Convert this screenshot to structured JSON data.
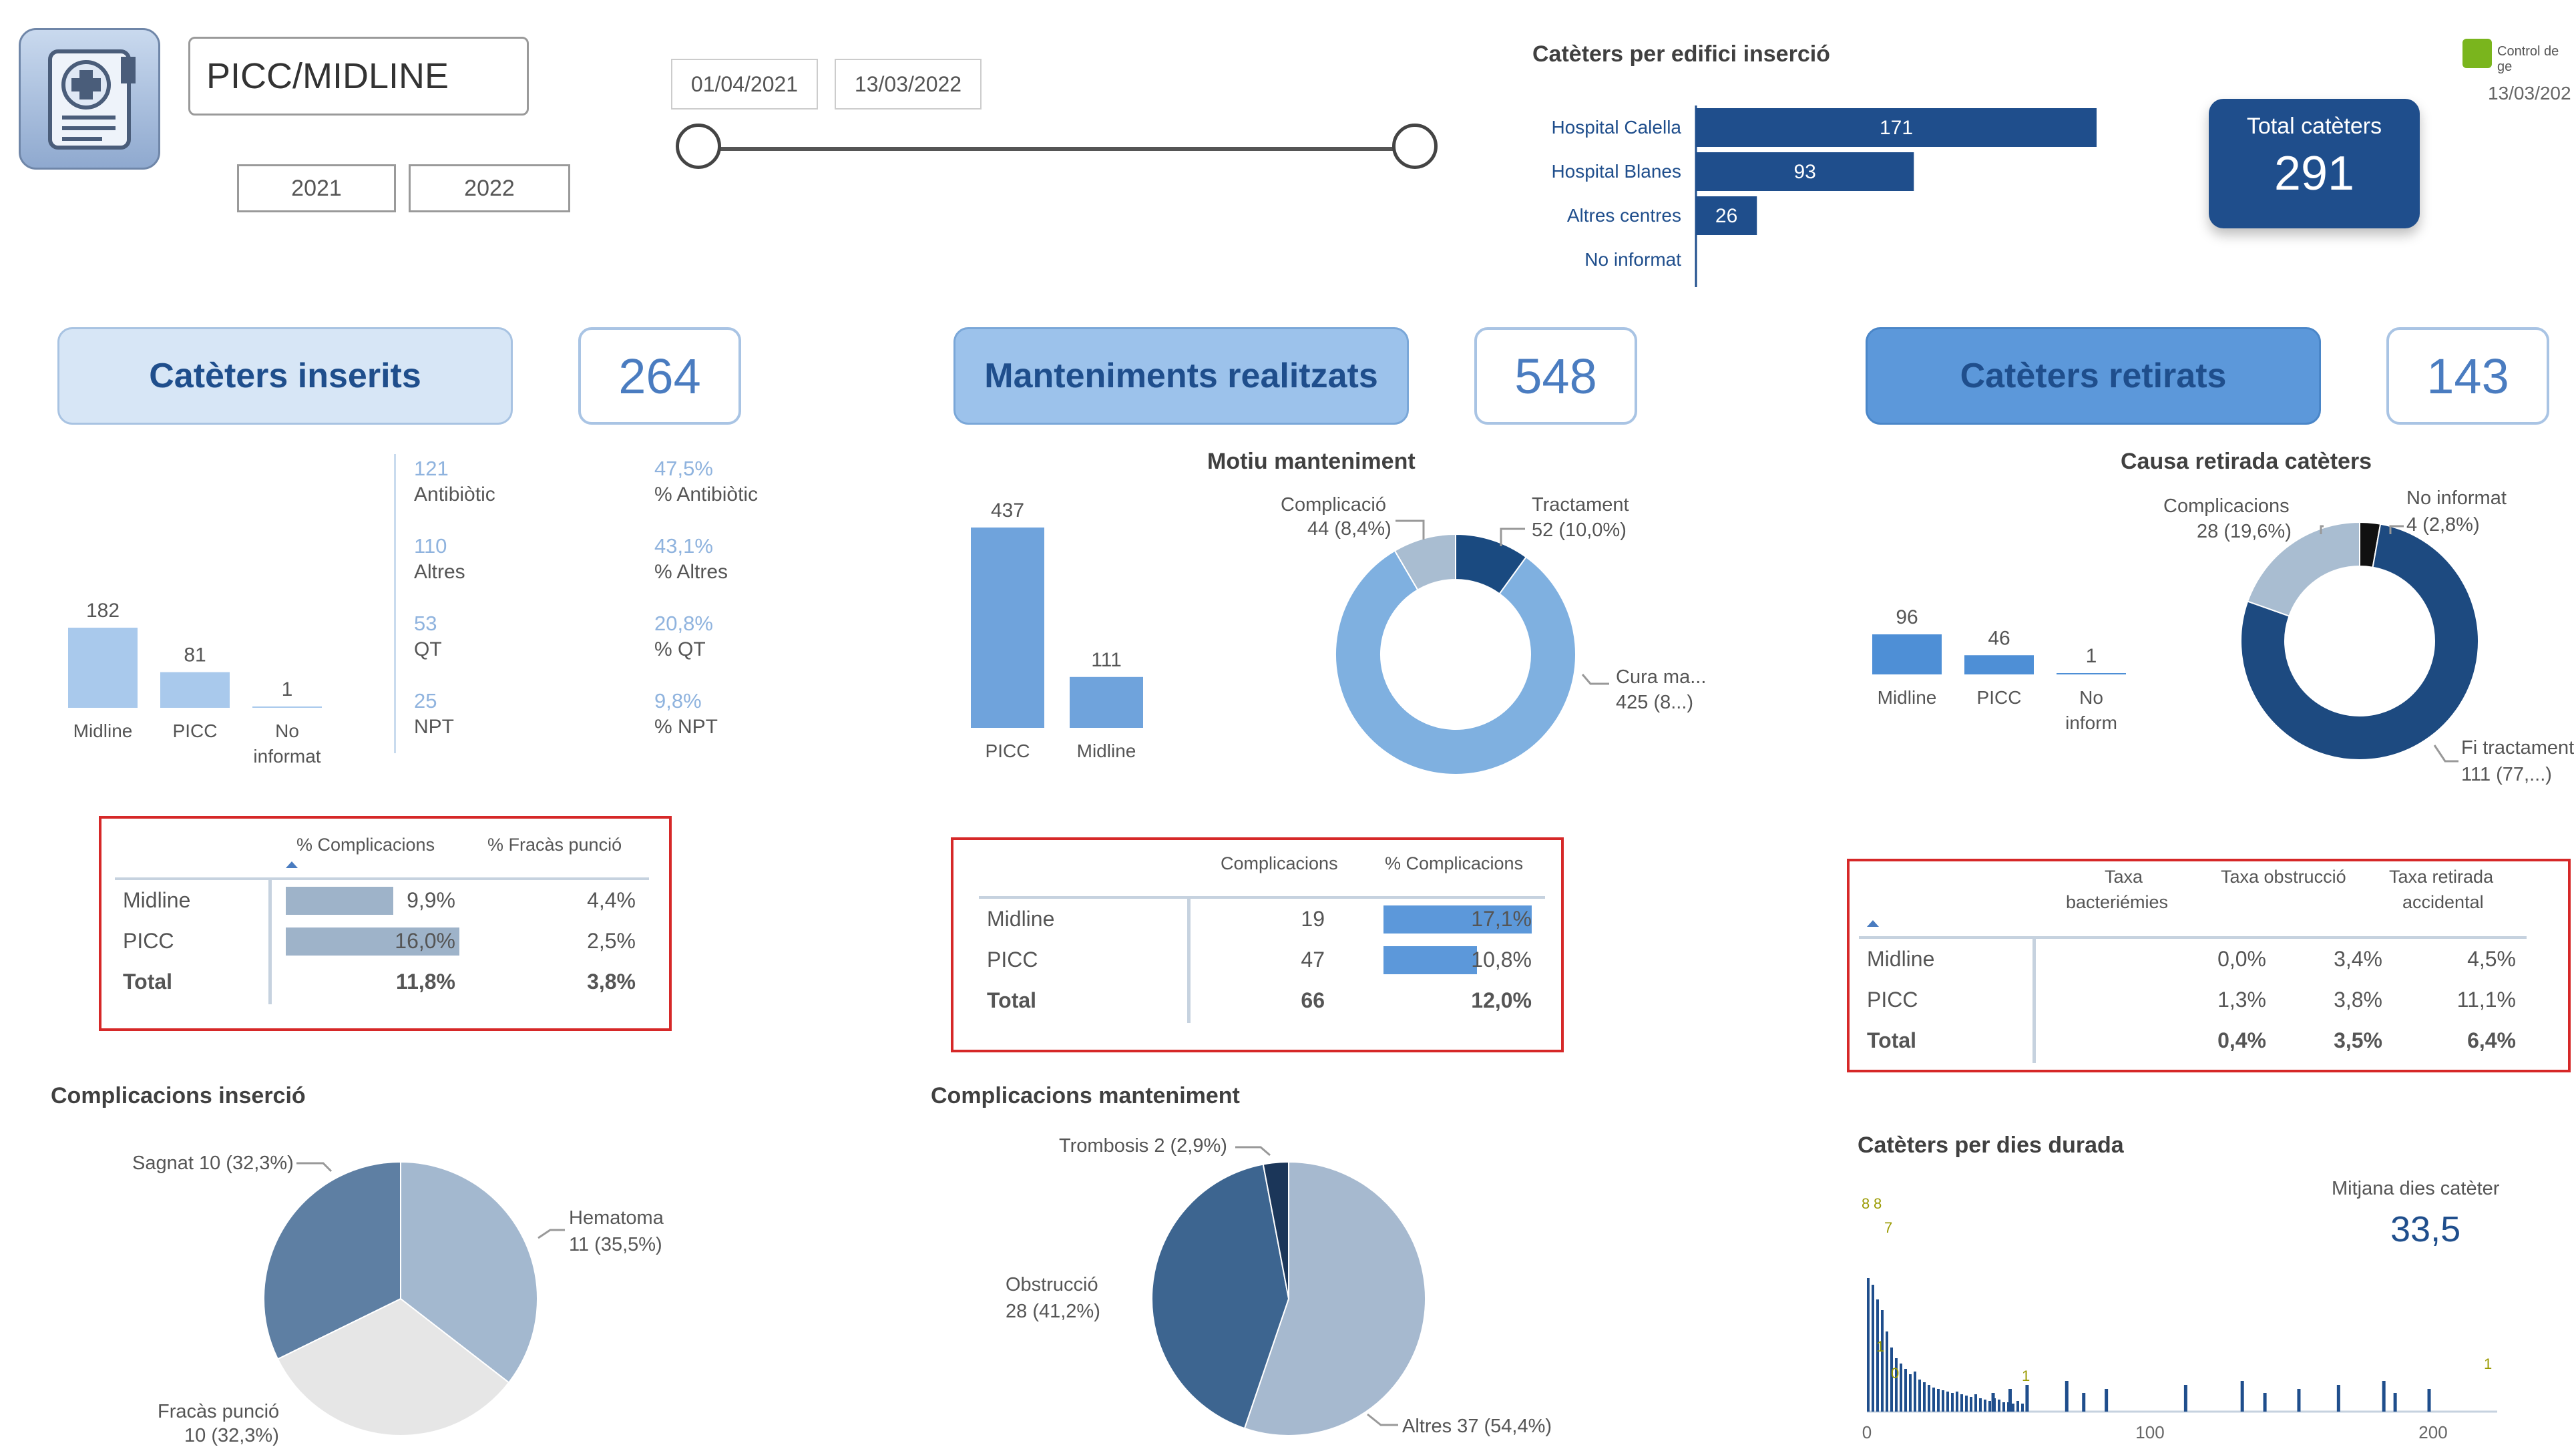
{
  "header": {
    "app_title": "PICC/MIDLINE",
    "year_buttons": [
      "2021",
      "2022"
    ],
    "date_start": "01/04/2021",
    "date_end": "13/03/2022",
    "brand_text": "Control de ge",
    "brand_date": "13/03/202"
  },
  "hospital_chart": {
    "title": "Catèters per edifici inserció",
    "bars": [
      {
        "label": "Hospital Calella",
        "value": 171
      },
      {
        "label": "Hospital Blanes",
        "value": 93
      },
      {
        "label": "Altres centres",
        "value": 26
      },
      {
        "label": "No informat",
        "value": 0
      }
    ],
    "value_labels": [
      "171",
      "93",
      "26"
    ]
  },
  "total_card": {
    "label": "Total catèters",
    "value": "291"
  },
  "sections": {
    "inserits": {
      "label": "Catèters inserits",
      "count": "264"
    },
    "manteniments": {
      "label": "Manteniments realitzats",
      "count": "548"
    },
    "retirats": {
      "label": "Catèters retirats",
      "count": "143"
    }
  },
  "inserits_bars": {
    "bars": [
      {
        "label": "Midline",
        "value": 182
      },
      {
        "label": "PICC",
        "value": 81
      },
      {
        "label": "No\ninformat",
        "value": 1
      }
    ],
    "value_labels": [
      "182",
      "81",
      "1"
    ],
    "label_1": "Midline",
    "label_2": "PICC",
    "label_3a": "No",
    "label_3b": "informat"
  },
  "inserits_kpis": [
    {
      "value": "121",
      "label": "Antibiòtic",
      "pct": "47,5%",
      "pct_label": "% Antibiòtic"
    },
    {
      "value": "110",
      "label": "Altres",
      "pct": "43,1%",
      "pct_label": "% Altres"
    },
    {
      "value": "53",
      "label": "QT",
      "pct": "20,8%",
      "pct_label": "% QT"
    },
    {
      "value": "25",
      "label": "NPT",
      "pct": "9,8%",
      "pct_label": "% NPT"
    }
  ],
  "inserits_table": {
    "headers": [
      "% Complicacions",
      "% Fracàs punció"
    ],
    "rows": [
      {
        "name": "Midline",
        "comp": "9,9%",
        "comp_val": 9.9,
        "fracas": "4,4%"
      },
      {
        "name": "PICC",
        "comp": "16,0%",
        "comp_val": 16.0,
        "fracas": "2,5%"
      },
      {
        "name": "Total",
        "comp": "11,8%",
        "fracas": "3,8%"
      }
    ]
  },
  "manteniments_bars": {
    "bars": [
      {
        "label": "PICC",
        "value": 437
      },
      {
        "label": "Midline",
        "value": 111
      }
    ],
    "value_labels": [
      "437",
      "111"
    ]
  },
  "motiu_donut": {
    "title": "Motiu manteniment",
    "slices": [
      {
        "label": "Tractament",
        "value": 52,
        "text": "52 (10,0%)",
        "color": "#1a4a80"
      },
      {
        "label": "Cura ma...",
        "value": 425,
        "text": "425 (8...)",
        "color": "#7fb0e0"
      },
      {
        "label": "Complicació",
        "value": 44,
        "text": "44 (8,4%)",
        "color": "#a9bdd1"
      }
    ],
    "label_compl": "Complicació",
    "text_compl": "44 (8,4%)",
    "label_tract": "Tractament",
    "text_tract": "52 (10,0%)",
    "label_cura": "Cura ma...",
    "text_cura": "425 (8...)"
  },
  "manteniments_table": {
    "headers": [
      "Complicacions",
      "% Complicacions"
    ],
    "rows": [
      {
        "name": "Midline",
        "comp": "19",
        "pct": "17,1%",
        "pct_val": 17.1
      },
      {
        "name": "PICC",
        "comp": "47",
        "pct": "10,8%",
        "pct_val": 10.8
      },
      {
        "name": "Total",
        "comp": "66",
        "pct": "12,0%"
      }
    ]
  },
  "retirats_bars": {
    "bars": [
      {
        "label": "Midline",
        "value": 96
      },
      {
        "label": "PICC",
        "value": 46
      },
      {
        "label": "No inform",
        "value": 1
      }
    ],
    "value_labels": [
      "96",
      "46",
      "1"
    ],
    "label_1": "Midline",
    "label_2": "PICC",
    "label_3a": "No",
    "label_3b": "inform"
  },
  "causa_donut": {
    "title": "Causa retirada catèters",
    "slices": [
      {
        "label": "No informat",
        "value": 4,
        "text": "4 (2,8%)",
        "color": "#111111"
      },
      {
        "label": "Fi tractament",
        "value": 111,
        "text": "111 (77,...)",
        "color": "#1d4a80"
      },
      {
        "label": "Complicacions",
        "value": 28,
        "text": "28 (19,6%)",
        "color": "#a9bdd1"
      }
    ],
    "label_compl": "Complicacions",
    "text_compl": "28 (19,6%)",
    "label_noinf": "No informat",
    "text_noinf": "4 (2,8%)",
    "label_fi": "Fi tractament",
    "text_fi": "111 (77,...)"
  },
  "retirats_table": {
    "headers": [
      "Taxa bacterièmies",
      "Taxa obstrucció",
      "Taxa retirada accidental"
    ],
    "h1a": "Taxa",
    "h1b": "bacteriémies",
    "h2": "Taxa obstrucció",
    "h3a": "Taxa retirada",
    "h3b": "accidental",
    "rows": [
      {
        "name": "Midline",
        "bact": "0,0%",
        "obst": "3,4%",
        "acc": "4,5%"
      },
      {
        "name": "PICC",
        "bact": "1,3%",
        "obst": "3,8%",
        "acc": "11,1%"
      },
      {
        "name": "Total",
        "bact": "0,4%",
        "obst": "3,5%",
        "acc": "6,4%"
      }
    ]
  },
  "insercio_pie": {
    "title": "Complicacions inserció",
    "slices": [
      {
        "label": "Hematoma",
        "value": 11,
        "color": "#a3b8cf"
      },
      {
        "label": "Fracàs punció",
        "value": 10,
        "color": "#e6e6e6"
      },
      {
        "label": "Sagnat",
        "value": 10,
        "color": "#5e7fa3"
      }
    ],
    "text_sagnat": "Sagnat 10 (32,3%)",
    "text_hem_a": "Hematoma",
    "text_hem_b": "11 (35,5%)",
    "text_fra_a": "Fracàs punció",
    "text_fra_b": "10 (32,3%)"
  },
  "manteniment_pie": {
    "title": "Complicacions manteniment",
    "slices": [
      {
        "label": "Altres",
        "value": 37,
        "color": "#a6b9cf"
      },
      {
        "label": "Obstrucció",
        "value": 28,
        "color": "#3d6590"
      },
      {
        "label": "Trombosis",
        "value": 2,
        "color": "#1b3659"
      }
    ],
    "text_trom": "Trombosis 2 (2,9%)",
    "text_obs_a": "Obstrucció",
    "text_obs_b": "28 (41,2%)",
    "text_alt": "Altres 37 (54,4%)"
  },
  "durada": {
    "title": "Catèters per dies durada",
    "mitjana_label": "Mitjana dies catèter",
    "mitjana_value": "33,5",
    "ticks": [
      "0",
      "100",
      "200"
    ],
    "peak_labels": [
      "8",
      "8",
      "7",
      "1",
      "0",
      "1",
      "1"
    ]
  }
}
